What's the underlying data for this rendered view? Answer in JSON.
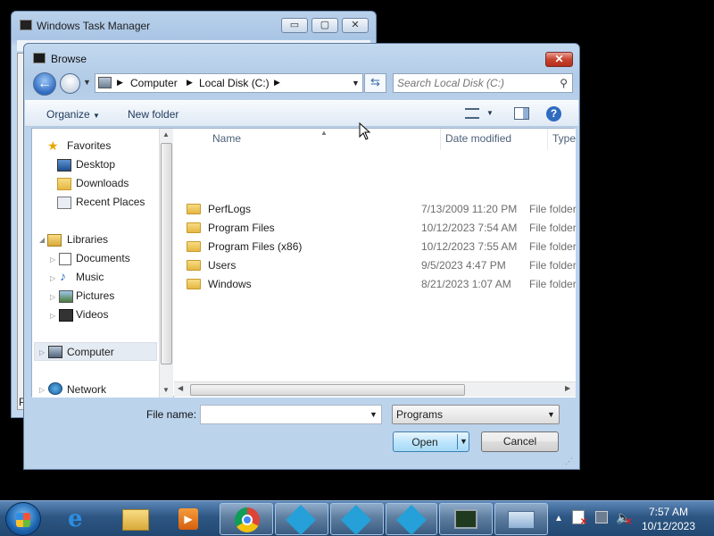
{
  "task_manager": {
    "title": "Windows Task Manager",
    "minimize": "▭",
    "maximize": "▢",
    "close": "✕",
    "partial_text": "P"
  },
  "dialog": {
    "title": "Browse",
    "close": "✕",
    "breadcrumbs": [
      "Computer",
      "Local Disk (C:)"
    ],
    "search_placeholder": "Search Local Disk (C:)",
    "toolbar": {
      "organize": "Organize",
      "new_folder": "New folder"
    },
    "nav": {
      "favorites": "Favorites",
      "favorites_items": [
        "Desktop",
        "Downloads",
        "Recent Places"
      ],
      "libraries": "Libraries",
      "libraries_items": [
        "Documents",
        "Music",
        "Pictures",
        "Videos"
      ],
      "computer": "Computer",
      "network": "Network"
    },
    "columns": {
      "name": "Name",
      "date": "Date modified",
      "type": "Type"
    },
    "files": [
      {
        "name": "PerfLogs",
        "date": "7/13/2009 11:20 PM",
        "type": "File folder"
      },
      {
        "name": "Program Files",
        "date": "10/12/2023 7:54 AM",
        "type": "File folder"
      },
      {
        "name": "Program Files (x86)",
        "date": "10/12/2023 7:55 AM",
        "type": "File folder"
      },
      {
        "name": "Users",
        "date": "9/5/2023 4:47 PM",
        "type": "File folder"
      },
      {
        "name": "Windows",
        "date": "8/21/2023 1:07 AM",
        "type": "File folder"
      }
    ],
    "file_name_label": "File name:",
    "file_name_value": "",
    "file_type": "Programs",
    "open": "Open",
    "cancel": "Cancel"
  },
  "taskbar": {
    "time": "7:57 AM",
    "date": "10/12/2023",
    "apps": [
      "internet-explorer",
      "file-explorer",
      "media-player",
      "chrome",
      "kodi",
      "kodi",
      "kodi",
      "task-manager",
      "remote-desktop"
    ]
  },
  "colors": {
    "title_bar": "#bcd3ec",
    "close_red": "#c7452f",
    "taskbar": "#2d5683",
    "kodi_blue": "#25a0d8"
  }
}
